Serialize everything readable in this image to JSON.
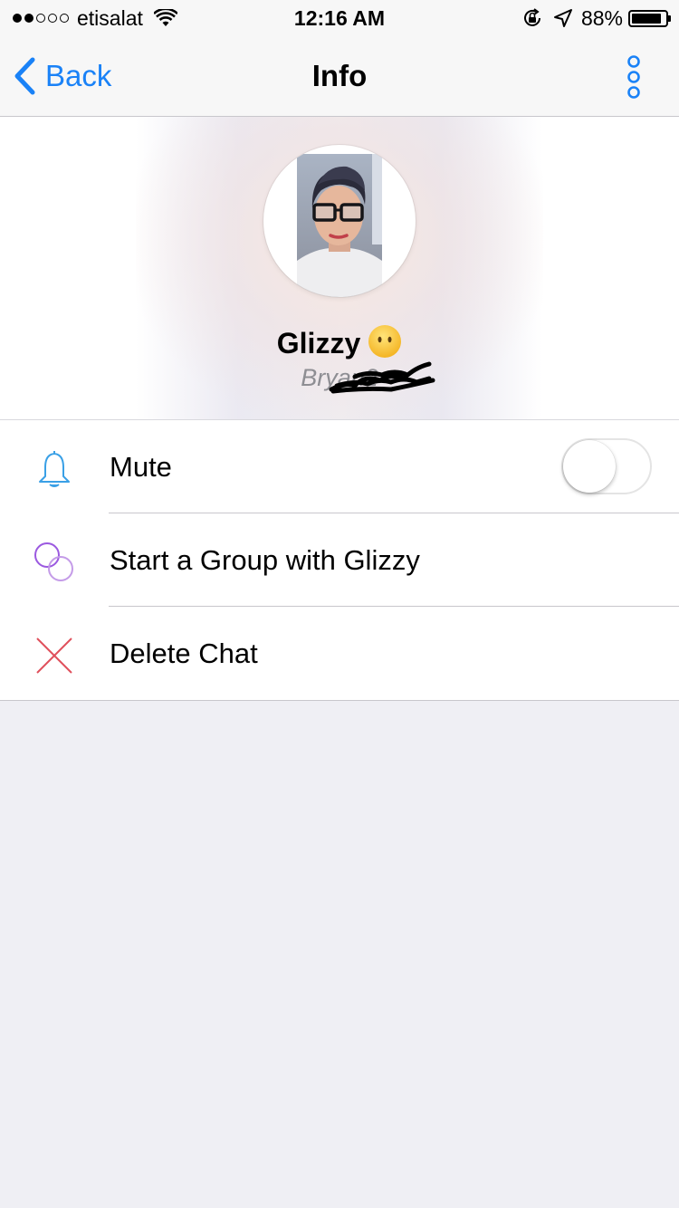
{
  "status_bar": {
    "carrier": "etisalat",
    "signal_bars_filled": 2,
    "signal_bars_total": 5,
    "time": "12:16 AM",
    "battery_percent": "88%",
    "battery_level": 0.88
  },
  "nav": {
    "back_label": "Back",
    "title": "Info",
    "accent_color": "#1a82f7"
  },
  "profile": {
    "name": "Glizzy",
    "emoji": "no-mouth-face",
    "username": "Bryan2"
  },
  "menu": {
    "items": [
      {
        "label": "Mute",
        "icon": "bell-icon",
        "has_toggle": true,
        "toggle_on": false
      },
      {
        "label": "Start a Group with Glizzy",
        "icon": "group-circles-icon"
      },
      {
        "label": "Delete Chat",
        "icon": "x-icon"
      }
    ]
  },
  "colors": {
    "bell": "#3aa0e6",
    "group": "#9b59e0",
    "delete": "#e0505c",
    "background": "#efeff4"
  }
}
